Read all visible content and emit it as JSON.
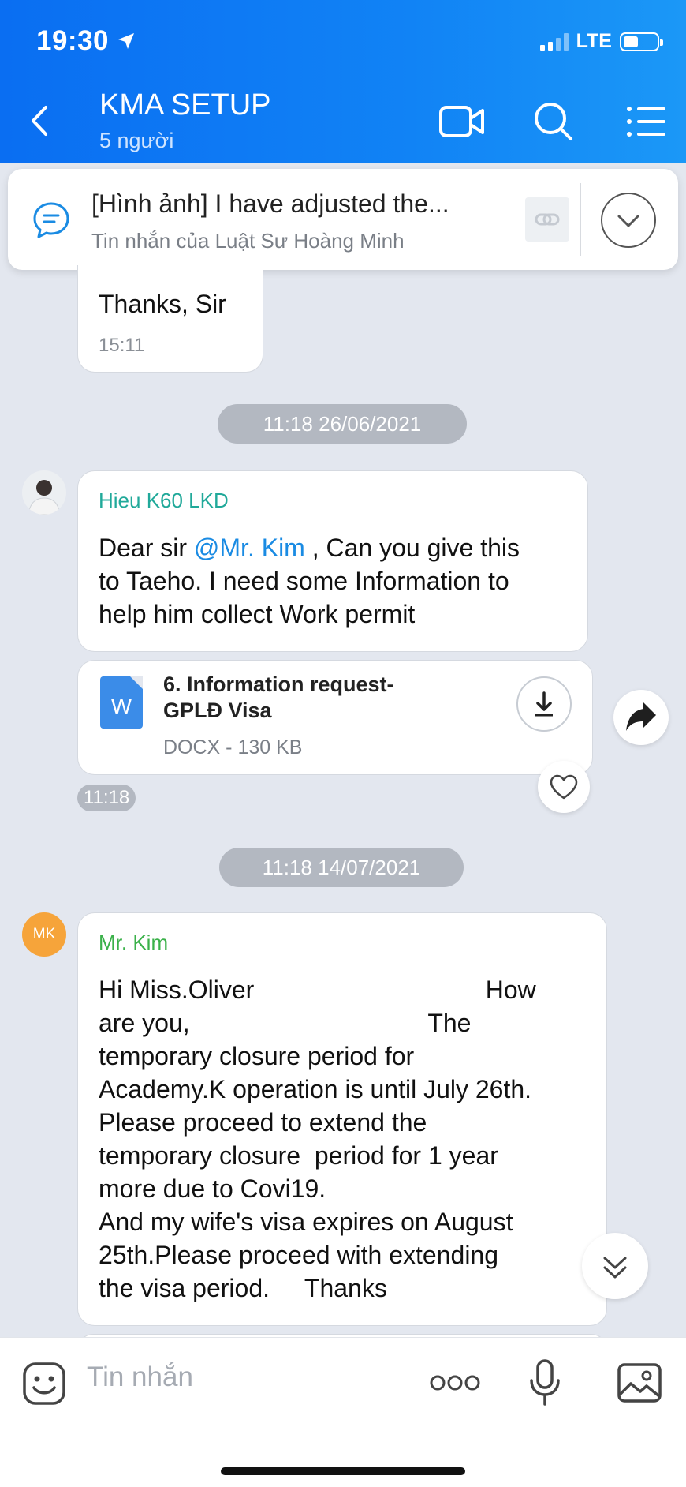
{
  "status": {
    "time": "19:30",
    "network": "LTE"
  },
  "header": {
    "title": "KMA SETUP",
    "subtitle": "5 người"
  },
  "pinned": {
    "title": "[Hình ảnh] I have adjusted the...",
    "subtitle": "Tin nhắn của Luật Sư Hoàng Minh"
  },
  "messages": {
    "m1": {
      "text": "Thanks, Sir",
      "time": "15:11"
    },
    "date1": "11:18 26/06/2021",
    "m2": {
      "sender": "Hieu K60 LKD",
      "text_before": "Dear sir ",
      "mention": "@Mr. Kim",
      "text_after": " , Can you give this\nto Taeho. I need some Information to\nhelp him collect Work permit"
    },
    "file": {
      "icon_letter": "W",
      "name": "6. Information request-\nGPLĐ Visa",
      "meta": "DOCX - 130 KB",
      "time": "11:18"
    },
    "date2": "11:18 14/07/2021",
    "m3": {
      "avatar_initials": "MK",
      "sender": "Mr. Kim",
      "text": "Hi Miss.Oliver                                 How\nare you,                                  The\ntemporary closure period for\nAcademy.K operation is until July 26th.\nPlease proceed to extend the\ntemporary closure  period for 1 year\nmore due to Covi19.\nAnd my wife's visa expires on August\n25th.Please proceed with extending\nthe visa period.     Thanks"
    }
  },
  "input": {
    "placeholder": "Tin nhắn"
  },
  "colors": {
    "header": "#0a6ef2",
    "mention": "#1a8be3",
    "sender_teal": "#21a99a",
    "sender_green": "#3bb14a",
    "avatar_mk": "#f6a43a"
  }
}
